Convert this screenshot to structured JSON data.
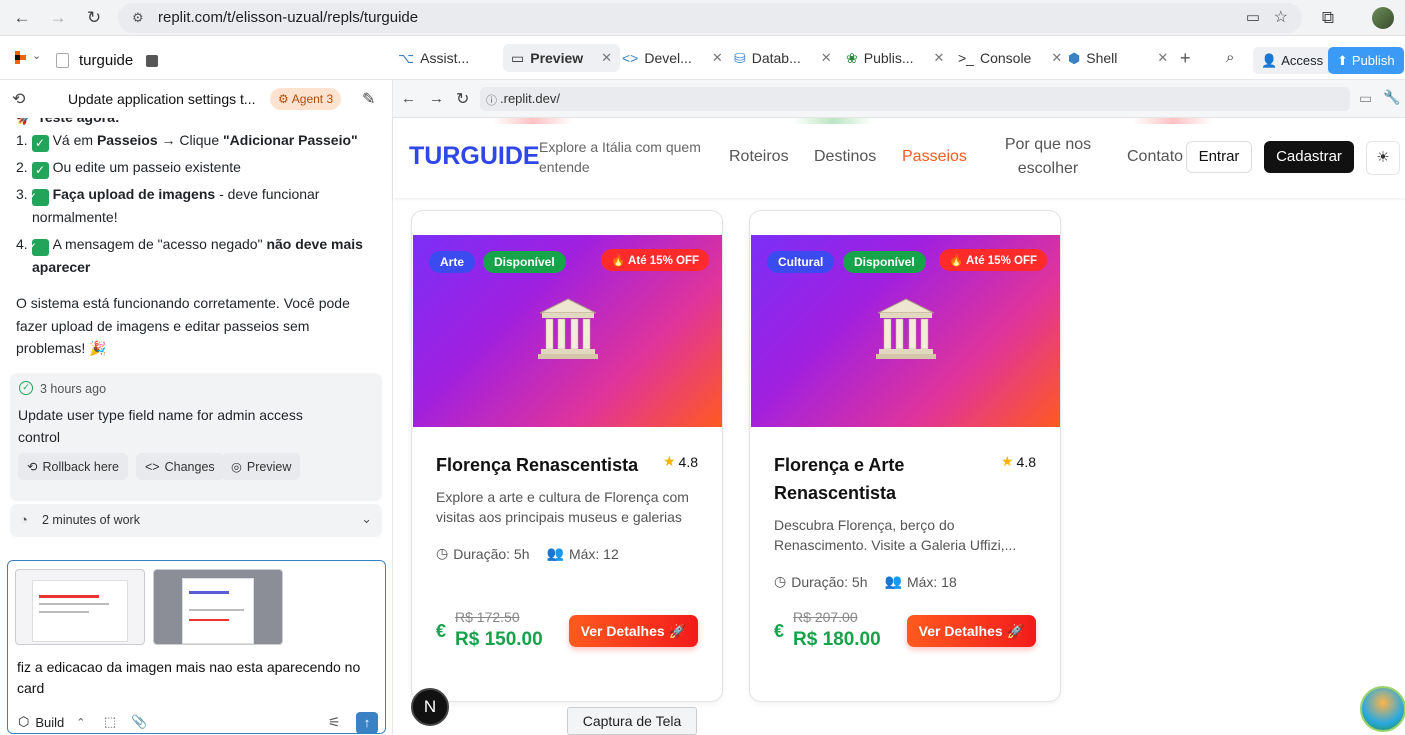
{
  "browser": {
    "url": "replit.com/t/elisson-uzual/repls/turguide"
  },
  "header": {
    "project_name": "turguide",
    "tabs": [
      {
        "label": "Assist...",
        "icon": "assistant-icon"
      },
      {
        "label": "Preview",
        "icon": "preview-icon"
      },
      {
        "label": "Devel...",
        "icon": "code-icon"
      },
      {
        "label": "Datab...",
        "icon": "database-icon"
      },
      {
        "label": "Publis...",
        "icon": "publish-icon"
      },
      {
        "label": "Console",
        "icon": "terminal-icon"
      },
      {
        "label": "Shell",
        "icon": "shell-icon"
      }
    ],
    "access_label": "Access",
    "publish_label": "Publish"
  },
  "chat": {
    "title": "Update application settings t...",
    "agent_badge": "Agent 3",
    "heading_partial": "Teste agora:",
    "steps": [
      {
        "num": "1.",
        "pre": "Vá em ",
        "bold": "Passeios",
        "mid": " → Clique ",
        "bold2": "\"Adicionar Passeio\"",
        "post": ""
      },
      {
        "num": "2.",
        "pre": "Ou edite um passeio existente",
        "bold": "",
        "mid": "",
        "bold2": "",
        "post": ""
      },
      {
        "num": "3.",
        "pre": "",
        "bold": "Faça upload de imagens",
        "mid": " - deve funcionar normalmente!",
        "bold2": "",
        "post": ""
      },
      {
        "num": "4.",
        "pre": "A mensagem de \"acesso negado\" ",
        "bold": "não deve mais aparecer",
        "mid": "",
        "bold2": "",
        "post": ""
      }
    ],
    "summary": "O sistema está funcionando corretamente. Você pode fazer upload de imagens e editar passeios sem problemas! 🎉",
    "checkpoint": {
      "time": "3 hours ago",
      "text": "Update user type field name for admin access control",
      "rollback": "Rollback here",
      "changes": "Changes",
      "preview": "Preview"
    },
    "work_summary": "2 minutes of work",
    "input_text": "fiz a edicacao da imagen mais nao esta aparecendo no card",
    "build_label": "Build"
  },
  "preview": {
    "url": ".replit.dev/",
    "site": {
      "logo": "TURGUIDE",
      "tagline": "Explore a Itália com quem entende",
      "nav": [
        "Roteiros",
        "Destinos",
        "Passeios",
        "Por que nos escolher",
        "Contato"
      ],
      "active_nav": "Passeios",
      "login": "Entrar",
      "signup": "Cadastrar"
    },
    "cards": [
      {
        "category": "Arte",
        "status": "Disponível",
        "offer": "🔥 Até 15% OFF",
        "title": "Florença Renascentista",
        "rating": "4.8",
        "description": "Explore a arte e cultura de Florença com visitas aos principais museus e galerias",
        "duration": "Duração: 5h",
        "max": "Máx: 12",
        "old_price": "R$ 172.50",
        "price": "R$ 150.00",
        "button": "Ver Detalhes 🚀"
      },
      {
        "category": "Cultural",
        "status": "Disponível",
        "offer": "🔥 Até 15% OFF",
        "title": "Florença e Arte Renascentista",
        "rating": "4.8",
        "description": "Descubra Florença, berço do Renascimento. Visite a Galeria Uffizi,...",
        "duration": "Duração: 5h",
        "max": "Máx: 18",
        "old_price": "R$ 207.00",
        "price": "R$ 180.00",
        "button": "Ver Detalhes 🚀"
      }
    ],
    "screenshot_tooltip": "Captura de Tela",
    "next_badge": "N",
    "colors": {
      "brand": "#2f47e6",
      "accent": "#ff5a1f",
      "price": "#16a34a",
      "publish": "#3b9af5"
    }
  }
}
